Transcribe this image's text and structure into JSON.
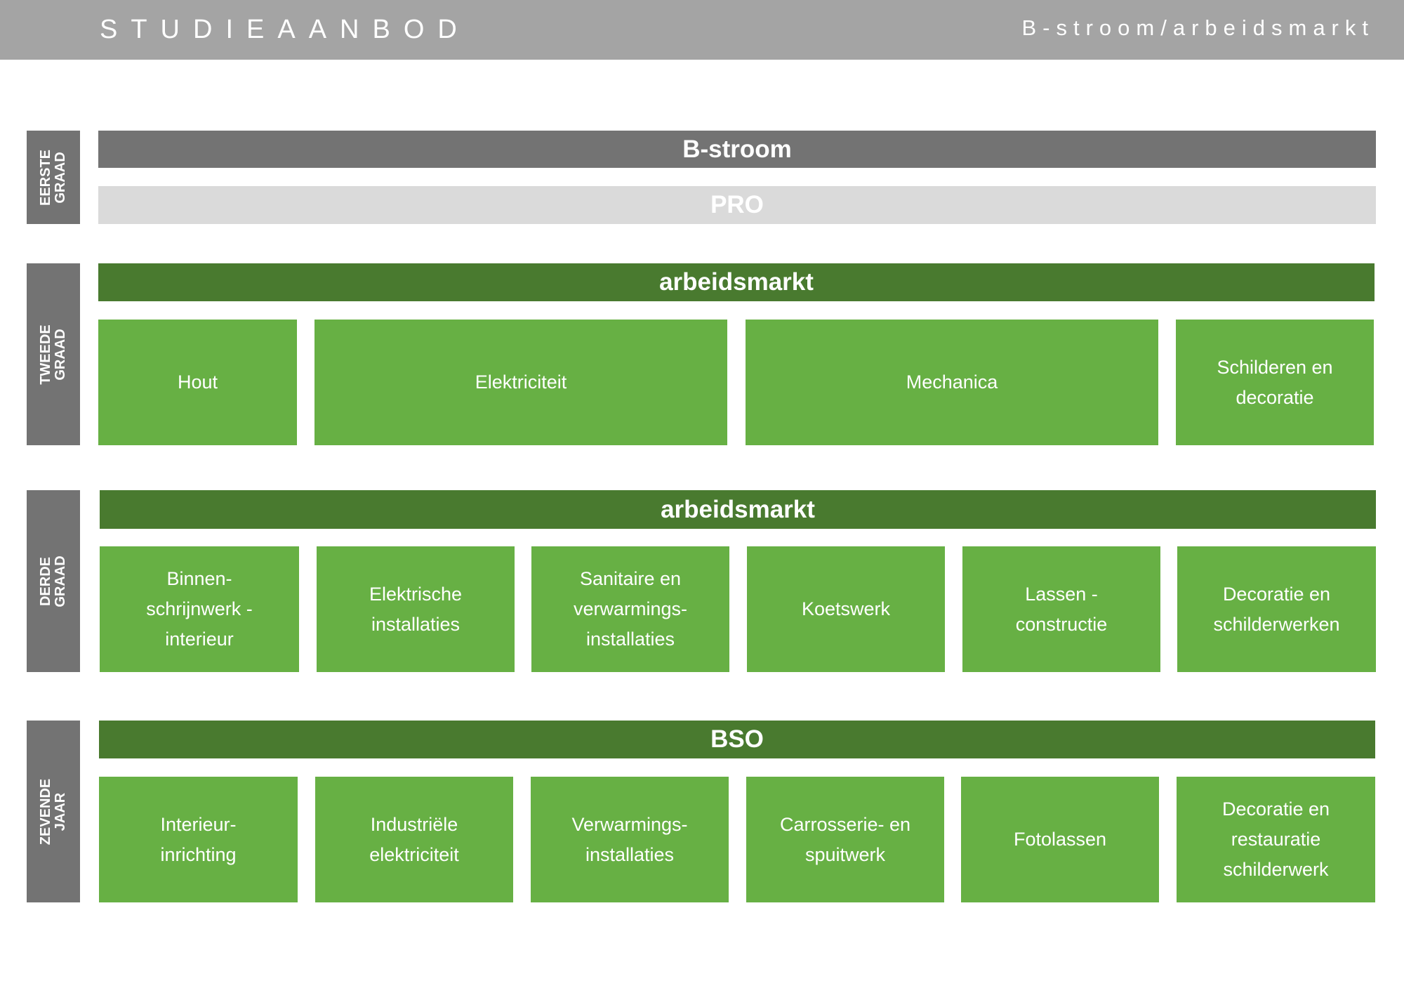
{
  "header": {
    "title": "STUDIEAANBOD",
    "subtitle": "B-stroom/arbeidsmarkt"
  },
  "rows": {
    "eerste": {
      "label": "EERSTE\nGRAAD",
      "bar1": "B-stroom",
      "bar2": "PRO"
    },
    "tweede": {
      "label": "TWEEDE\nGRAAD",
      "bar": "arbeidsmarkt",
      "boxes": [
        "Hout",
        "Elektriciteit",
        "Mechanica",
        "Schilderen en\ndecoratie"
      ]
    },
    "derde": {
      "label": "DERDE\nGRAAD",
      "bar": "arbeidsmarkt",
      "boxes": [
        "Binnen-\nschrijnwerk -\ninterieur",
        "Elektrische\ninstallaties",
        "Sanitaire en\nverwarmings-\ninstallaties",
        "Koetswerk",
        "Lassen -\nconstructie",
        "Decoratie en\nschilderwerken"
      ]
    },
    "zevende": {
      "label": "ZEVENDE\nJAAR",
      "bar": "BSO",
      "boxes": [
        "Interieur-\ninrichting",
        "Industriële\nelektriciteit",
        "Verwarmings-\ninstallaties",
        "Carrosserie- en\nspuitwerk",
        "Fotolassen",
        "Decoratie en\nrestauratie\nschilderwerk"
      ]
    }
  },
  "colors": {
    "header": "#a4a4a4",
    "side": "#737373",
    "dark_green": "#497a2f",
    "light_green": "#67b044",
    "light_grey": "#dadada"
  }
}
